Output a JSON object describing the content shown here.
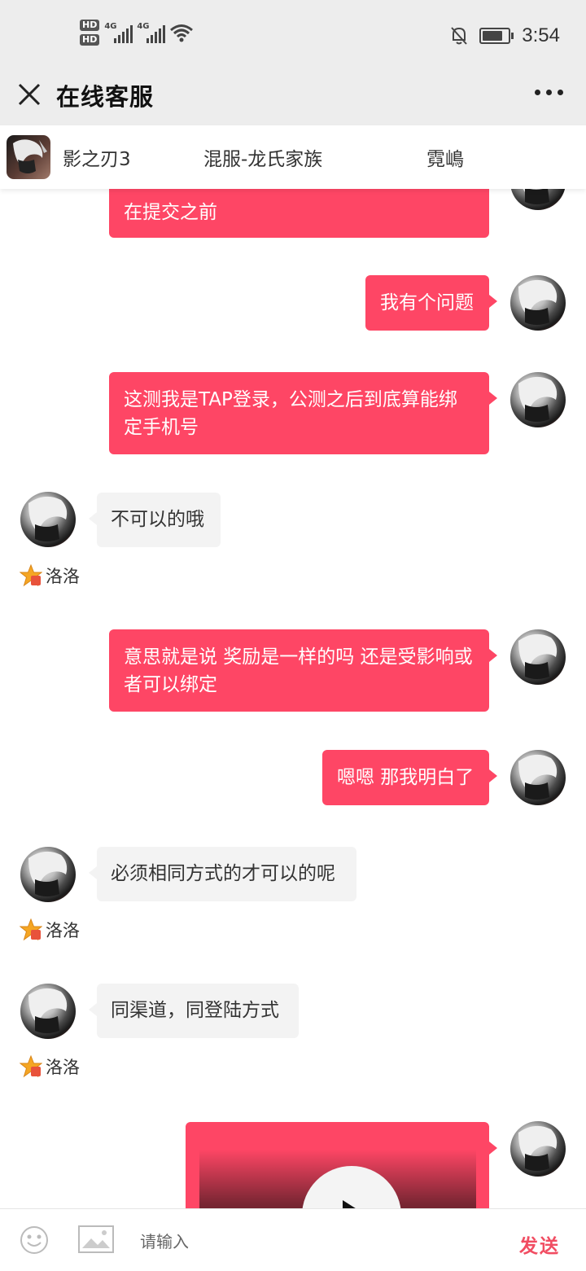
{
  "status_bar": {
    "hd1": "HD",
    "hd2": "HD",
    "net1": "4G",
    "net2": "4G",
    "time": "3:54",
    "battery_level": 0.85
  },
  "header": {
    "title": "在线客服"
  },
  "game_bar": {
    "game_name": "影之刃3",
    "server": "混服-龙氏家族",
    "role": "霓嶋"
  },
  "messages": {
    "m0": "在提交之前",
    "m1": "我有个问题",
    "m2": "这测我是TAP登录，公测之后到底算能绑定手机号",
    "m3": "不可以的哦",
    "m4": "意思就是说 奖励是一样的吗 还是受影响或者可以绑定",
    "m5": "嗯嗯 那我明白了",
    "m6": "必须相同方式的才可以的呢",
    "m7": "同渠道，同登陆方式"
  },
  "agent": {
    "name": "洛洛"
  },
  "input_bar": {
    "placeholder": "请输入",
    "send_label": "发送"
  },
  "colors": {
    "outgoing_bubble": "#fe4665",
    "incoming_bubble": "#f3f3f3",
    "send_text": "#f14d62",
    "bar_bg": "#ededed"
  }
}
